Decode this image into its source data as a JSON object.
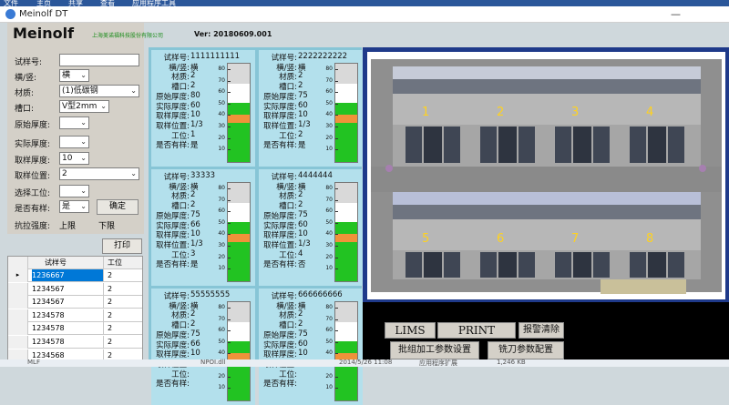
{
  "ribbon": {
    "items": [
      "文件",
      "主页",
      "共享",
      "查看",
      "应用程序工具"
    ]
  },
  "window": {
    "title": "Meinolf DT"
  },
  "header": {
    "brand": "Meinolf",
    "company": "上海美诺福科技股份有限公司",
    "version": "Ver: 20180609.001"
  },
  "form": {
    "sample_no": {
      "label": "试样号:",
      "value": ""
    },
    "orientation": {
      "label": "横/竖:",
      "value": "横"
    },
    "material": {
      "label": "材质:",
      "value": "(1)低碳钢"
    },
    "groove": {
      "label": "槽口:",
      "value": "V型2mm"
    },
    "orig_thickness": {
      "label": "原始厚度:",
      "value": ""
    },
    "actual_thickness": {
      "label": "实际厚度:",
      "value": ""
    },
    "take_thickness": {
      "label": "取样厚度:",
      "value": "10"
    },
    "take_position": {
      "label": "取样位置:",
      "value": "2"
    },
    "station": {
      "label": "选择工位:",
      "value": ""
    },
    "has_sample": {
      "label": "是否有样:",
      "value": "是"
    },
    "confirm_label": "确定",
    "tensile_label": "抗拉强度:",
    "upper": "上限",
    "lower": "下限"
  },
  "print_label": "打印",
  "table": {
    "headers": [
      "试样号",
      "工位"
    ],
    "rows": [
      {
        "id": "1236667",
        "station": "2"
      },
      {
        "id": "1234567",
        "station": "2"
      },
      {
        "id": "1234567",
        "station": "2"
      },
      {
        "id": "1234578",
        "station": "2"
      },
      {
        "id": "1234578",
        "station": "2"
      },
      {
        "id": "1234578",
        "station": "2"
      },
      {
        "id": "1234568",
        "station": "2"
      }
    ]
  },
  "card_labels": {
    "sample": "试样号:",
    "orient": "横/竖:",
    "material": "材质:",
    "groove": "槽口:",
    "orig": "原始厚度:",
    "actual": "实际厚度:",
    "take": "取样厚度:",
    "pos": "取样位置:",
    "station": "工位:",
    "has": "是否有样:"
  },
  "cards": [
    {
      "sample": "1111111111",
      "orient": "横",
      "material": "2",
      "groove": "2",
      "orig": "80",
      "actual": "60",
      "take": "10",
      "pos": "1/3",
      "station": "1",
      "has": "是",
      "level": 0.6,
      "mark": 0.4
    },
    {
      "sample": "2222222222",
      "orient": "横",
      "material": "2",
      "groove": "2",
      "orig": "75",
      "actual": "60",
      "take": "10",
      "pos": "1/3",
      "station": "2",
      "has": "是",
      "level": 0.6,
      "mark": 0.4
    },
    {
      "sample": "33333",
      "orient": "横",
      "material": "2",
      "groove": "2",
      "orig": "75",
      "actual": "66",
      "take": "10",
      "pos": "1/3",
      "station": "3",
      "has": "是",
      "level": 0.6,
      "mark": 0.4
    },
    {
      "sample": "4444444",
      "orient": "横",
      "material": "2",
      "groove": "2",
      "orig": "75",
      "actual": "60",
      "take": "10",
      "pos": "1/3",
      "station": "4",
      "has": "否",
      "level": 0.6,
      "mark": 0.4
    },
    {
      "sample": "55555555",
      "orient": "横",
      "material": "2",
      "groove": "2",
      "orig": "75",
      "actual": "66",
      "take": "10",
      "pos": "",
      "station": "",
      "has": "",
      "level": 0.6,
      "mark": 0.4
    },
    {
      "sample": "666666666",
      "orient": "横",
      "material": "2",
      "groove": "2",
      "orig": "75",
      "actual": "60",
      "take": "10",
      "pos": "",
      "station": "",
      "has": "",
      "level": 0.6,
      "mark": 0.4
    }
  ],
  "gauge_ticks": [
    "80",
    "70",
    "60",
    "50",
    "40",
    "30",
    "20",
    "10"
  ],
  "machine": {
    "stations": [
      "1",
      "2",
      "3",
      "4",
      "5",
      "6",
      "7",
      "8"
    ]
  },
  "buttons": {
    "lims": "LIMS",
    "print": "PRINT",
    "alarm_clear": "报警清除",
    "batch": "批组加工参数设置",
    "mill": "铣刀参数配置"
  },
  "statusbar": {
    "file": "MLF",
    "date": "2014/5/26 11:08",
    "type": "应用程序扩展",
    "size": "1,246 KB",
    "name": "NPOI.dll"
  },
  "colors": {
    "card_bg": "#b3e0ec",
    "grid_bg": "#87c5d6",
    "gauge_green": "#22c322",
    "gauge_mark": "#f0923a",
    "frame_blue": "#1f3a8a"
  }
}
